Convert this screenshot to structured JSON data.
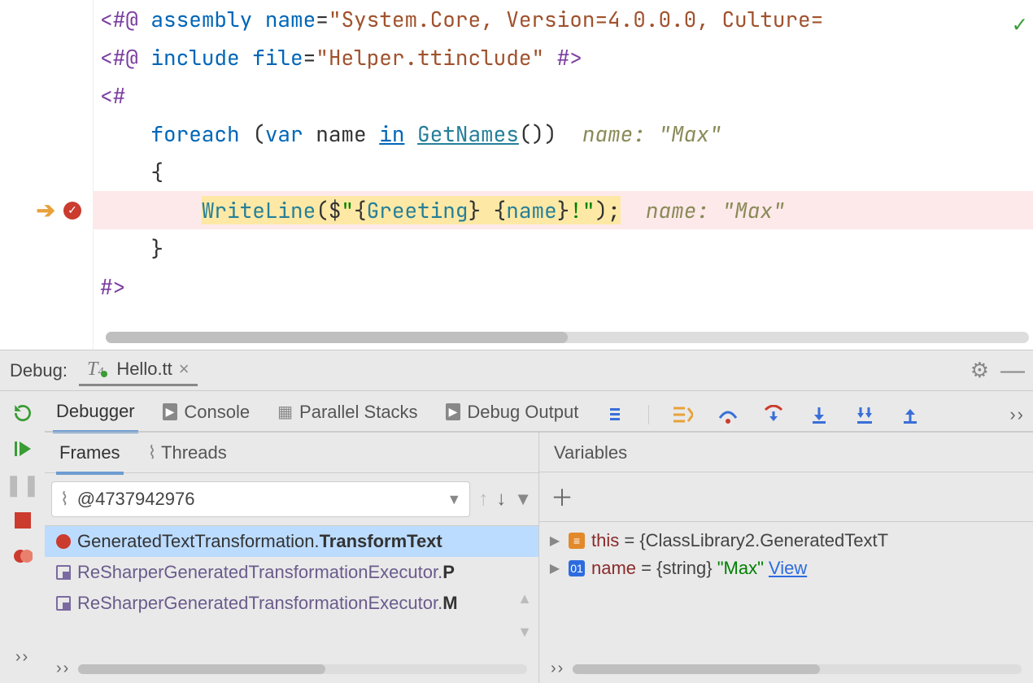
{
  "editor": {
    "line1": {
      "tag_open": "<#@",
      "dir": " assembly",
      "attr": " name",
      "eq": "=",
      "str": "\"System.Core, Version=4.0.0.0, Culture="
    },
    "line2": {
      "tag_open": "<#@",
      "dir": " include",
      "attr": " file",
      "eq": "=",
      "str": "\"Helper.ttinclude\"",
      "close": " #>"
    },
    "line3": {
      "tag_open": "<#"
    },
    "line4": {
      "indent": "    ",
      "kw": "foreach",
      "paren": " (",
      "var": "var",
      "name": " name ",
      "in": "in",
      "space": " ",
      "call": "GetNames",
      "post": "())  ",
      "hint": "name: \"Max\""
    },
    "line5": {
      "indent": "    ",
      "brace": "{"
    },
    "line6": {
      "indent": "        ",
      "fn": "WriteLine",
      "args_pre": "($",
      "q1": "\"",
      "tmpl1": "{",
      "g": "Greeting",
      "tmpl2": "} {",
      "n": "name",
      "tmpl3": "}",
      "bang": "!",
      "q2": "\"",
      "close": ");",
      "hint": "  name: \"Max\""
    },
    "line7": {
      "indent": "    ",
      "brace": "}"
    },
    "line8": {
      "tag_close": "#>"
    }
  },
  "panel": {
    "title": "Debug:",
    "tab_label": "Hello.tt"
  },
  "debugger_tabs": [
    "Debugger",
    "Console",
    "Parallel Stacks",
    "Debug Output"
  ],
  "frames": {
    "tab_frames": "Frames",
    "tab_threads": "Threads",
    "thread_value": "@4737942976",
    "items": [
      {
        "pre": "GeneratedTextTransformation.",
        "bold": "TransformText",
        "sel": true,
        "kind": "bp"
      },
      {
        "pre": "ReSharperGeneratedTransformationExecutor.",
        "bold": "P",
        "sel": false,
        "kind": "p"
      },
      {
        "pre": "ReSharperGeneratedTransformationExecutor.",
        "bold": "M",
        "sel": false,
        "kind": "p"
      }
    ]
  },
  "variables": {
    "title": "Variables",
    "rows": [
      {
        "icon": "orange",
        "name": "this",
        "rest": " = {ClassLibrary2.GeneratedTextT"
      },
      {
        "icon": "blue",
        "name": "name",
        "rest": " = {string} ",
        "str": "\"Max\"",
        "link": "View"
      }
    ]
  }
}
